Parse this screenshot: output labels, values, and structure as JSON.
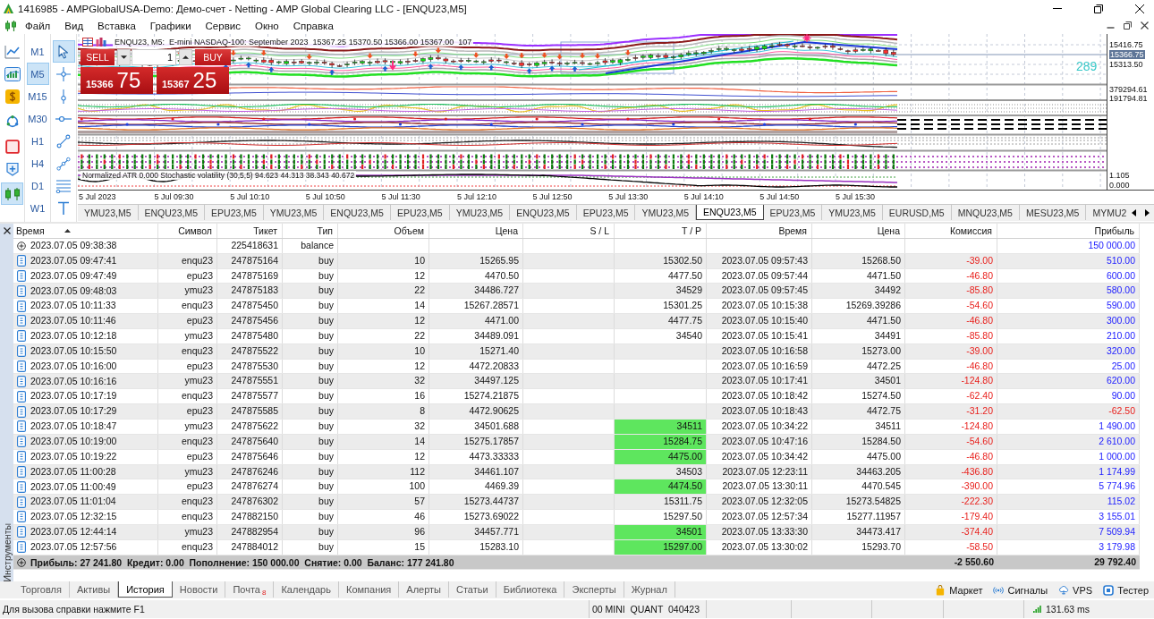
{
  "window": {
    "title": "1416985 - AMPGlobalUSA-Demo: Демо-счет - Netting - AMP Global Clearing LLC - [ENQU23,M5]"
  },
  "menu": [
    "Файл",
    "Вид",
    "Вставка",
    "Графики",
    "Сервис",
    "Окно",
    "Справка"
  ],
  "toolbar": [
    {
      "kind": "line",
      "selected": false
    },
    {
      "kind": "window",
      "selected": false
    },
    {
      "kind": "dollar",
      "selected": false
    },
    {
      "kind": "network",
      "selected": false
    },
    {
      "kind": "stop",
      "selected": false
    },
    {
      "kind": "add",
      "selected": false
    },
    {
      "kind": "bars",
      "selected": true
    }
  ],
  "timeframes": [
    {
      "label": "M1",
      "selected": false
    },
    {
      "label": "M5",
      "selected": true
    },
    {
      "label": "M15",
      "selected": false
    },
    {
      "label": "M30",
      "selected": false
    },
    {
      "label": "H1",
      "selected": false
    },
    {
      "label": "H4",
      "selected": false
    },
    {
      "label": "D1",
      "selected": false
    },
    {
      "label": "W1",
      "selected": false
    }
  ],
  "drawing_tools": [
    {
      "kind": "cursor",
      "selected": true
    },
    {
      "kind": "crosshair",
      "selected": false
    },
    {
      "kind": "vline",
      "selected": false
    },
    {
      "kind": "hline",
      "selected": false
    },
    {
      "kind": "trendline",
      "selected": false
    },
    {
      "kind": "polyline",
      "selected": false
    },
    {
      "kind": "channel",
      "selected": false
    },
    {
      "kind": "text",
      "selected": false
    }
  ],
  "chart": {
    "header": "ENQU23, M5:  E-mini NASDAQ-100: September 2023  15367.25 15370.50 15366.00 15367.00  107",
    "price_labels": [
      "15416.75",
      "15313.50"
    ],
    "current_price": "15366.75",
    "tick_counter": "289",
    "indicator_scale_labels": [
      "379294.61",
      "191794.81"
    ],
    "oscillator_caption": "Normalized ATR 0.000 Stochastic volatility (30,5,5) 94.623 44.313 38.343 40.672",
    "oscillator_scale_labels": [
      "1.105",
      "0.000"
    ],
    "time_labels": [
      "5 Jul 2023",
      "5 Jul 09:30",
      "5 Jul 10:10",
      "5 Jul 10:50",
      "5 Jul 11:30",
      "5 Jul 12:10",
      "5 Jul 12:50",
      "5 Jul 13:30",
      "5 Jul 14:10",
      "5 Jul 14:50",
      "5 Jul 15:30"
    ]
  },
  "trade_panel": {
    "sell_label": "SELL",
    "buy_label": "BUY",
    "volume": "1",
    "sell_price": {
      "main": "15366",
      "pips": "75"
    },
    "buy_price": {
      "main": "15367",
      "pips": "25"
    }
  },
  "chart_tabs": [
    {
      "label": "YMU23,M5",
      "selected": false
    },
    {
      "label": "ENQU23,M5",
      "selected": false
    },
    {
      "label": "EPU23,M5",
      "selected": false
    },
    {
      "label": "YMU23,M5",
      "selected": false
    },
    {
      "label": "ENQU23,M5",
      "selected": false
    },
    {
      "label": "EPU23,M5",
      "selected": false
    },
    {
      "label": "YMU23,M5",
      "selected": false
    },
    {
      "label": "ENQU23,M5",
      "selected": false
    },
    {
      "label": "EPU23,M5",
      "selected": false
    },
    {
      "label": "YMU23,M5",
      "selected": false
    },
    {
      "label": "ENQU23,M5",
      "selected": true
    },
    {
      "label": "EPU23,M5",
      "selected": false
    },
    {
      "label": "YMU23,M5",
      "selected": false
    },
    {
      "label": "EURUSD,M5",
      "selected": false
    },
    {
      "label": "MNQU23,M5",
      "selected": false
    },
    {
      "label": "MESU23,M5",
      "selected": false
    },
    {
      "label": "MYMU2",
      "selected": false
    }
  ],
  "toolbox": {
    "side_label": "Инструменты",
    "columns": [
      {
        "label": "Время",
        "sorted": true
      },
      {
        "label": "Символ",
        "sorted": false
      },
      {
        "label": "Тикет",
        "sorted": false
      },
      {
        "label": "Тип",
        "sorted": false
      },
      {
        "label": "Объем",
        "sorted": false
      },
      {
        "label": "Цена",
        "sorted": false
      },
      {
        "label": "S / L",
        "sorted": false
      },
      {
        "label": "T / P",
        "sorted": false
      },
      {
        "label": "Время",
        "sorted": false
      },
      {
        "label": "Цена",
        "sorted": false
      },
      {
        "label": "Комиссия",
        "sorted": false
      },
      {
        "label": "Прибыль",
        "sorted": false
      }
    ],
    "rows": [
      {
        "kind": "balance",
        "time": "2023.07.05 09:38:38",
        "ticket": "225418631",
        "type": "balance",
        "profit": "150 000.00",
        "loss": false
      },
      {
        "kind": "deal",
        "time": "2023.07.05 09:47:41",
        "symbol": "enqu23",
        "ticket": "247875164",
        "type": "buy",
        "volume": "10",
        "price": "15265.95",
        "tp": {
          "text": "15302.50",
          "highlighted": false
        },
        "close_time": "2023.07.05 09:57:43",
        "close_price": "15268.50",
        "commission": "-39.00",
        "profit": "510.00",
        "loss": false
      },
      {
        "kind": "deal",
        "time": "2023.07.05 09:47:49",
        "symbol": "epu23",
        "ticket": "247875169",
        "type": "buy",
        "volume": "12",
        "price": "4470.50",
        "tp": {
          "text": "4477.50",
          "highlighted": false
        },
        "close_time": "2023.07.05 09:57:44",
        "close_price": "4471.50",
        "commission": "-46.80",
        "profit": "600.00",
        "loss": false
      },
      {
        "kind": "deal",
        "time": "2023.07.05 09:48:03",
        "symbol": "ymu23",
        "ticket": "247875183",
        "type": "buy",
        "volume": "22",
        "price": "34486.727",
        "tp": {
          "text": "34529",
          "highlighted": false
        },
        "close_time": "2023.07.05 09:57:45",
        "close_price": "34492",
        "commission": "-85.80",
        "profit": "580.00",
        "loss": false
      },
      {
        "kind": "deal",
        "time": "2023.07.05 10:11:33",
        "symbol": "enqu23",
        "ticket": "247875450",
        "type": "buy",
        "volume": "14",
        "price": "15267.28571",
        "tp": {
          "text": "15301.25",
          "highlighted": false
        },
        "close_time": "2023.07.05 10:15:38",
        "close_price": "15269.39286",
        "commission": "-54.60",
        "profit": "590.00",
        "loss": false
      },
      {
        "kind": "deal",
        "time": "2023.07.05 10:11:46",
        "symbol": "epu23",
        "ticket": "247875456",
        "type": "buy",
        "volume": "12",
        "price": "4471.00",
        "tp": {
          "text": "4477.75",
          "highlighted": false
        },
        "close_time": "2023.07.05 10:15:40",
        "close_price": "4471.50",
        "commission": "-46.80",
        "profit": "300.00",
        "loss": false
      },
      {
        "kind": "deal",
        "time": "2023.07.05 10:12:18",
        "symbol": "ymu23",
        "ticket": "247875480",
        "type": "buy",
        "volume": "22",
        "price": "34489.091",
        "tp": {
          "text": "34540",
          "highlighted": false
        },
        "close_time": "2023.07.05 10:15:41",
        "close_price": "34491",
        "commission": "-85.80",
        "profit": "210.00",
        "loss": false
      },
      {
        "kind": "deal",
        "time": "2023.07.05 10:15:50",
        "symbol": "enqu23",
        "ticket": "247875522",
        "type": "buy",
        "volume": "10",
        "price": "15271.40",
        "close_time": "2023.07.05 10:16:58",
        "close_price": "15273.00",
        "commission": "-39.00",
        "profit": "320.00",
        "loss": false
      },
      {
        "kind": "deal",
        "time": "2023.07.05 10:16:00",
        "symbol": "epu23",
        "ticket": "247875530",
        "type": "buy",
        "volume": "12",
        "price": "4472.20833",
        "close_time": "2023.07.05 10:16:59",
        "close_price": "4472.25",
        "commission": "-46.80",
        "profit": "25.00",
        "loss": false
      },
      {
        "kind": "deal",
        "time": "2023.07.05 10:16:16",
        "symbol": "ymu23",
        "ticket": "247875551",
        "type": "buy",
        "volume": "32",
        "price": "34497.125",
        "close_time": "2023.07.05 10:17:41",
        "close_price": "34501",
        "commission": "-124.80",
        "profit": "620.00",
        "loss": false
      },
      {
        "kind": "deal",
        "time": "2023.07.05 10:17:19",
        "symbol": "enqu23",
        "ticket": "247875577",
        "type": "buy",
        "volume": "16",
        "price": "15274.21875",
        "close_time": "2023.07.05 10:18:42",
        "close_price": "15274.50",
        "commission": "-62.40",
        "profit": "90.00",
        "loss": false
      },
      {
        "kind": "deal",
        "time": "2023.07.05 10:17:29",
        "symbol": "epu23",
        "ticket": "247875585",
        "type": "buy",
        "volume": "8",
        "price": "4472.90625",
        "close_time": "2023.07.05 10:18:43",
        "close_price": "4472.75",
        "commission": "-31.20",
        "profit": "-62.50",
        "loss": true
      },
      {
        "kind": "deal",
        "time": "2023.07.05 10:18:47",
        "symbol": "ymu23",
        "ticket": "247875622",
        "type": "buy",
        "volume": "32",
        "price": "34501.688",
        "tp": {
          "text": "34511",
          "highlighted": true
        },
        "close_time": "2023.07.05 10:34:22",
        "close_price": "34511",
        "commission": "-124.80",
        "profit": "1 490.00",
        "loss": false
      },
      {
        "kind": "deal",
        "time": "2023.07.05 10:19:00",
        "symbol": "enqu23",
        "ticket": "247875640",
        "type": "buy",
        "volume": "14",
        "price": "15275.17857",
        "tp": {
          "text": "15284.75",
          "highlighted": true
        },
        "close_time": "2023.07.05 10:47:16",
        "close_price": "15284.50",
        "commission": "-54.60",
        "profit": "2 610.00",
        "loss": false
      },
      {
        "kind": "deal",
        "time": "2023.07.05 10:19:22",
        "symbol": "epu23",
        "ticket": "247875646",
        "type": "buy",
        "volume": "12",
        "price": "4473.33333",
        "tp": {
          "text": "4475.00",
          "highlighted": true
        },
        "close_time": "2023.07.05 10:34:42",
        "close_price": "4475.00",
        "commission": "-46.80",
        "profit": "1 000.00",
        "loss": false
      },
      {
        "kind": "deal",
        "time": "2023.07.05 11:00:28",
        "symbol": "ymu23",
        "ticket": "247876246",
        "type": "buy",
        "volume": "112",
        "price": "34461.107",
        "tp": {
          "text": "34503",
          "highlighted": false
        },
        "close_time": "2023.07.05 12:23:11",
        "close_price": "34463.205",
        "commission": "-436.80",
        "profit": "1 174.99",
        "loss": false
      },
      {
        "kind": "deal",
        "time": "2023.07.05 11:00:49",
        "symbol": "epu23",
        "ticket": "247876274",
        "type": "buy",
        "volume": "100",
        "price": "4469.39",
        "tp": {
          "text": "4474.50",
          "highlighted": true
        },
        "close_time": "2023.07.05 13:30:11",
        "close_price": "4470.545",
        "commission": "-390.00",
        "profit": "5 774.96",
        "loss": false
      },
      {
        "kind": "deal",
        "time": "2023.07.05 11:01:04",
        "symbol": "enqu23",
        "ticket": "247876302",
        "type": "buy",
        "volume": "57",
        "price": "15273.44737",
        "tp": {
          "text": "15311.75",
          "highlighted": false
        },
        "close_time": "2023.07.05 12:32:05",
        "close_price": "15273.54825",
        "commission": "-222.30",
        "profit": "115.02",
        "loss": false
      },
      {
        "kind": "deal",
        "time": "2023.07.05 12:32:15",
        "symbol": "enqu23",
        "ticket": "247882150",
        "type": "buy",
        "volume": "46",
        "price": "15273.69022",
        "tp": {
          "text": "15297.50",
          "highlighted": false
        },
        "close_time": "2023.07.05 12:57:34",
        "close_price": "15277.11957",
        "commission": "-179.40",
        "profit": "3 155.01",
        "loss": false
      },
      {
        "kind": "deal",
        "time": "2023.07.05 12:44:14",
        "symbol": "ymu23",
        "ticket": "247882954",
        "type": "buy",
        "volume": "96",
        "price": "34457.771",
        "tp": {
          "text": "34501",
          "highlighted": true
        },
        "close_time": "2023.07.05 13:33:30",
        "close_price": "34473.417",
        "commission": "-374.40",
        "profit": "7 509.94",
        "loss": false
      },
      {
        "kind": "deal",
        "time": "2023.07.05 12:57:56",
        "symbol": "enqu23",
        "ticket": "247884012",
        "type": "buy",
        "volume": "15",
        "price": "15283.10",
        "tp": {
          "text": "15297.00",
          "highlighted": true
        },
        "close_time": "2023.07.05 13:30:02",
        "close_price": "15293.70",
        "commission": "-58.50",
        "profit": "3 179.98",
        "loss": false
      }
    ],
    "summary": {
      "text": "Прибыль: 27 241.80  Кредит: 0.00  Пополнение: 150 000.00  Снятие: 0.00  Баланс: 177 241.80",
      "commission": "-2 550.60",
      "profit": "29 792.40"
    }
  },
  "toolbox_tabs": [
    {
      "label": "Торговля",
      "selected": false
    },
    {
      "label": "Активы",
      "selected": false
    },
    {
      "label": "История",
      "selected": true
    },
    {
      "label": "Новости",
      "selected": false
    },
    {
      "label": "Почта",
      "selected": false,
      "badge": "8"
    },
    {
      "label": "Календарь",
      "selected": false
    },
    {
      "label": "Компания",
      "selected": false
    },
    {
      "label": "Алерты",
      "selected": false
    },
    {
      "label": "Статьи",
      "selected": false
    },
    {
      "label": "Библиотека",
      "selected": false
    },
    {
      "label": "Эксперты",
      "selected": false
    },
    {
      "label": "Журнал",
      "selected": false
    }
  ],
  "services": [
    {
      "kind": "market",
      "label": "Маркет"
    },
    {
      "kind": "signals",
      "label": "Сигналы"
    },
    {
      "kind": "vps",
      "label": "VPS"
    },
    {
      "kind": "tester",
      "label": "Тестер"
    }
  ],
  "status_bar": {
    "help": "Для вызова справки нажмите F1",
    "profile": "00 MINI  QUANT  040423",
    "ping": "131.63 ms"
  }
}
